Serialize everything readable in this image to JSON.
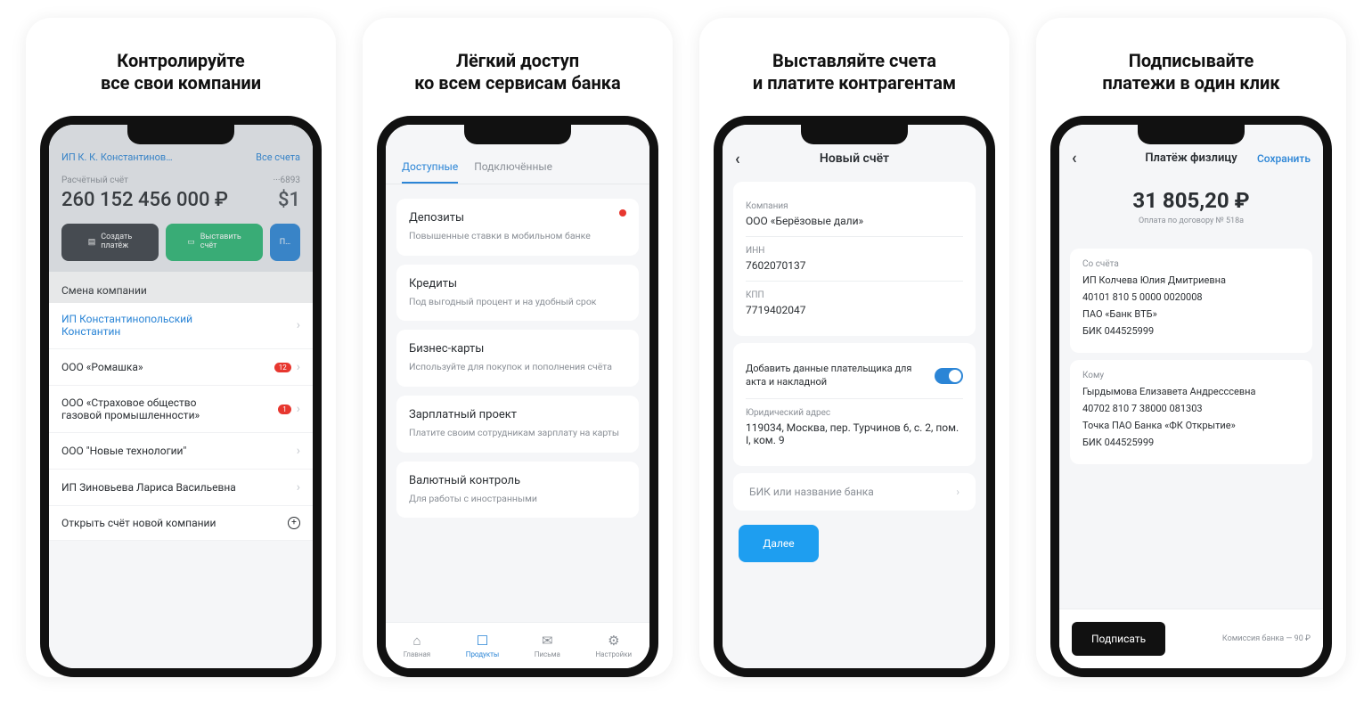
{
  "panel1": {
    "headline1": "Контролируйте",
    "headline2": "все свои компании",
    "company_selector": "ИП К. К. Константинов…",
    "all_accounts": "Все счета",
    "account_label": "Расчётный счёт",
    "account_masked": "···6893",
    "balance": "260 152 456 000 ₽",
    "balance_cut": "$1",
    "btn_create_line1": "Создать",
    "btn_create_line2": "платёж",
    "btn_invoice_line1": "Выставить",
    "btn_invoice_line2": "счёт",
    "btn_third": "П…",
    "section_title": "Смена компании",
    "items": [
      {
        "name": "ИП Константинопольский Константин",
        "active": true,
        "badge": ""
      },
      {
        "name": "ООО «Ромашка»",
        "active": false,
        "badge": "12"
      },
      {
        "name": "ООО «Страховое общество газовой промышленности»",
        "active": false,
        "badge": "1"
      },
      {
        "name": "ООО \"Новые технологии\"",
        "active": false,
        "badge": ""
      },
      {
        "name": "ИП Зиновьева Лариса Васильевна",
        "active": false,
        "badge": ""
      }
    ],
    "open_new": "Открыть счёт новой компании"
  },
  "panel2": {
    "headline1": "Лёгкий доступ",
    "headline2": "ко всем сервисам банка",
    "tab_active": "Доступные",
    "tab_other": "Подключённые",
    "cards": [
      {
        "title": "Депозиты",
        "desc": "Повышенные ставки в мобильном банке",
        "dot": true
      },
      {
        "title": "Кредиты",
        "desc": "Под выгодный процент и на удобный срок",
        "dot": false
      },
      {
        "title": "Бизнес-карты",
        "desc": "Используйте для покупок и пополнения счёта",
        "dot": false
      },
      {
        "title": "Зарплатный проект",
        "desc": "Платите своим сотрудникам зарплату на карты",
        "dot": false
      },
      {
        "title": "Валютный контроль",
        "desc": "Для работы с иностранными",
        "dot": false
      }
    ],
    "tabbar": {
      "home": "Главная",
      "products": "Продукты",
      "mail": "Письма",
      "settings": "Настройки"
    }
  },
  "panel3": {
    "headline1": "Выставляйте счета",
    "headline2": "и платите контрагентам",
    "title": "Новый счёт",
    "company_label": "Компания",
    "company_value": "ООО «Берёзовые дали»",
    "inn_label": "ИНН",
    "inn_value": "7602070137",
    "kpp_label": "КПП",
    "kpp_value": "7719402047",
    "toggle_text": "Добавить данные плательщика для акта и накладной",
    "addr_label": "Юридический адрес",
    "addr_value": "119034, Москва, пер. Турчинов 6, с. 2, пом. I, ком. 9",
    "bik_placeholder": "БИК или название банка",
    "next_btn": "Далее"
  },
  "panel4": {
    "headline1": "Подписывайте",
    "headline2": "платежи в один клик",
    "title": "Платёж физлицу",
    "save": "Сохранить",
    "amount": "31 805,20 ₽",
    "amount_sub": "Оплата по договору № 518а",
    "from_label": "Со счёта",
    "from_name": "ИП Колчева Юлия Дмитриевна",
    "from_acct": "40101 810 5 0000 0020008",
    "from_bank": "ПАО «Банк ВТБ»",
    "from_bik": "БИК 044525999",
    "to_label": "Кому",
    "to_name": "Гырдымова Елизавета Андресссевна",
    "to_acct": "40702 810 7 38000 081303",
    "to_bank": "Точка ПАО Банка «ФК Открытие»",
    "to_bik": "БИК 044525999",
    "sign_btn": "Подписать",
    "commission": "Комиссия банка — 90 ₽"
  }
}
